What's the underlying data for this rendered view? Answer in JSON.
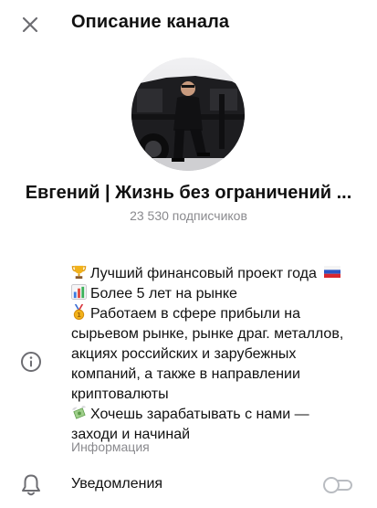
{
  "header": {
    "title": "Описание канала",
    "close_icon": "close-icon"
  },
  "channel": {
    "name": "Евгений | Жизнь без ограничений ...",
    "subscribers": "23 530 подписчиков",
    "avatar_description": "channel-avatar-photo"
  },
  "description": {
    "lines": [
      {
        "emoji": "trophy-emoji",
        "text": "Лучший финансовый проект года",
        "trail_emoji": "russia-flag-emoji"
      },
      {
        "emoji": "bar-chart-emoji",
        "text": "Более 5 лет на рынке"
      },
      {
        "emoji": "medal-emoji",
        "text": "Работаем в сфере прибыли на"
      },
      {
        "text": "сырьевом рынке, рынке драг. металлов,"
      },
      {
        "text": "акциях российских и зарубежных"
      },
      {
        "text": "компаний, а также в направлении"
      },
      {
        "text": "криптовалюты"
      },
      {
        "emoji": "flying-money-emoji",
        "text": "Хочешь зарабатывать с нами —"
      },
      {
        "text": "заходи и начинай"
      }
    ],
    "label": "Информация",
    "icon": "info-icon"
  },
  "notifications": {
    "label": "Уведомления",
    "icon": "bell-icon",
    "enabled": false
  },
  "colors": {
    "text_primary": "#111111",
    "text_secondary": "#8a8a8e",
    "toggle_off": "#b9bcc1",
    "background": "#ffffff"
  }
}
